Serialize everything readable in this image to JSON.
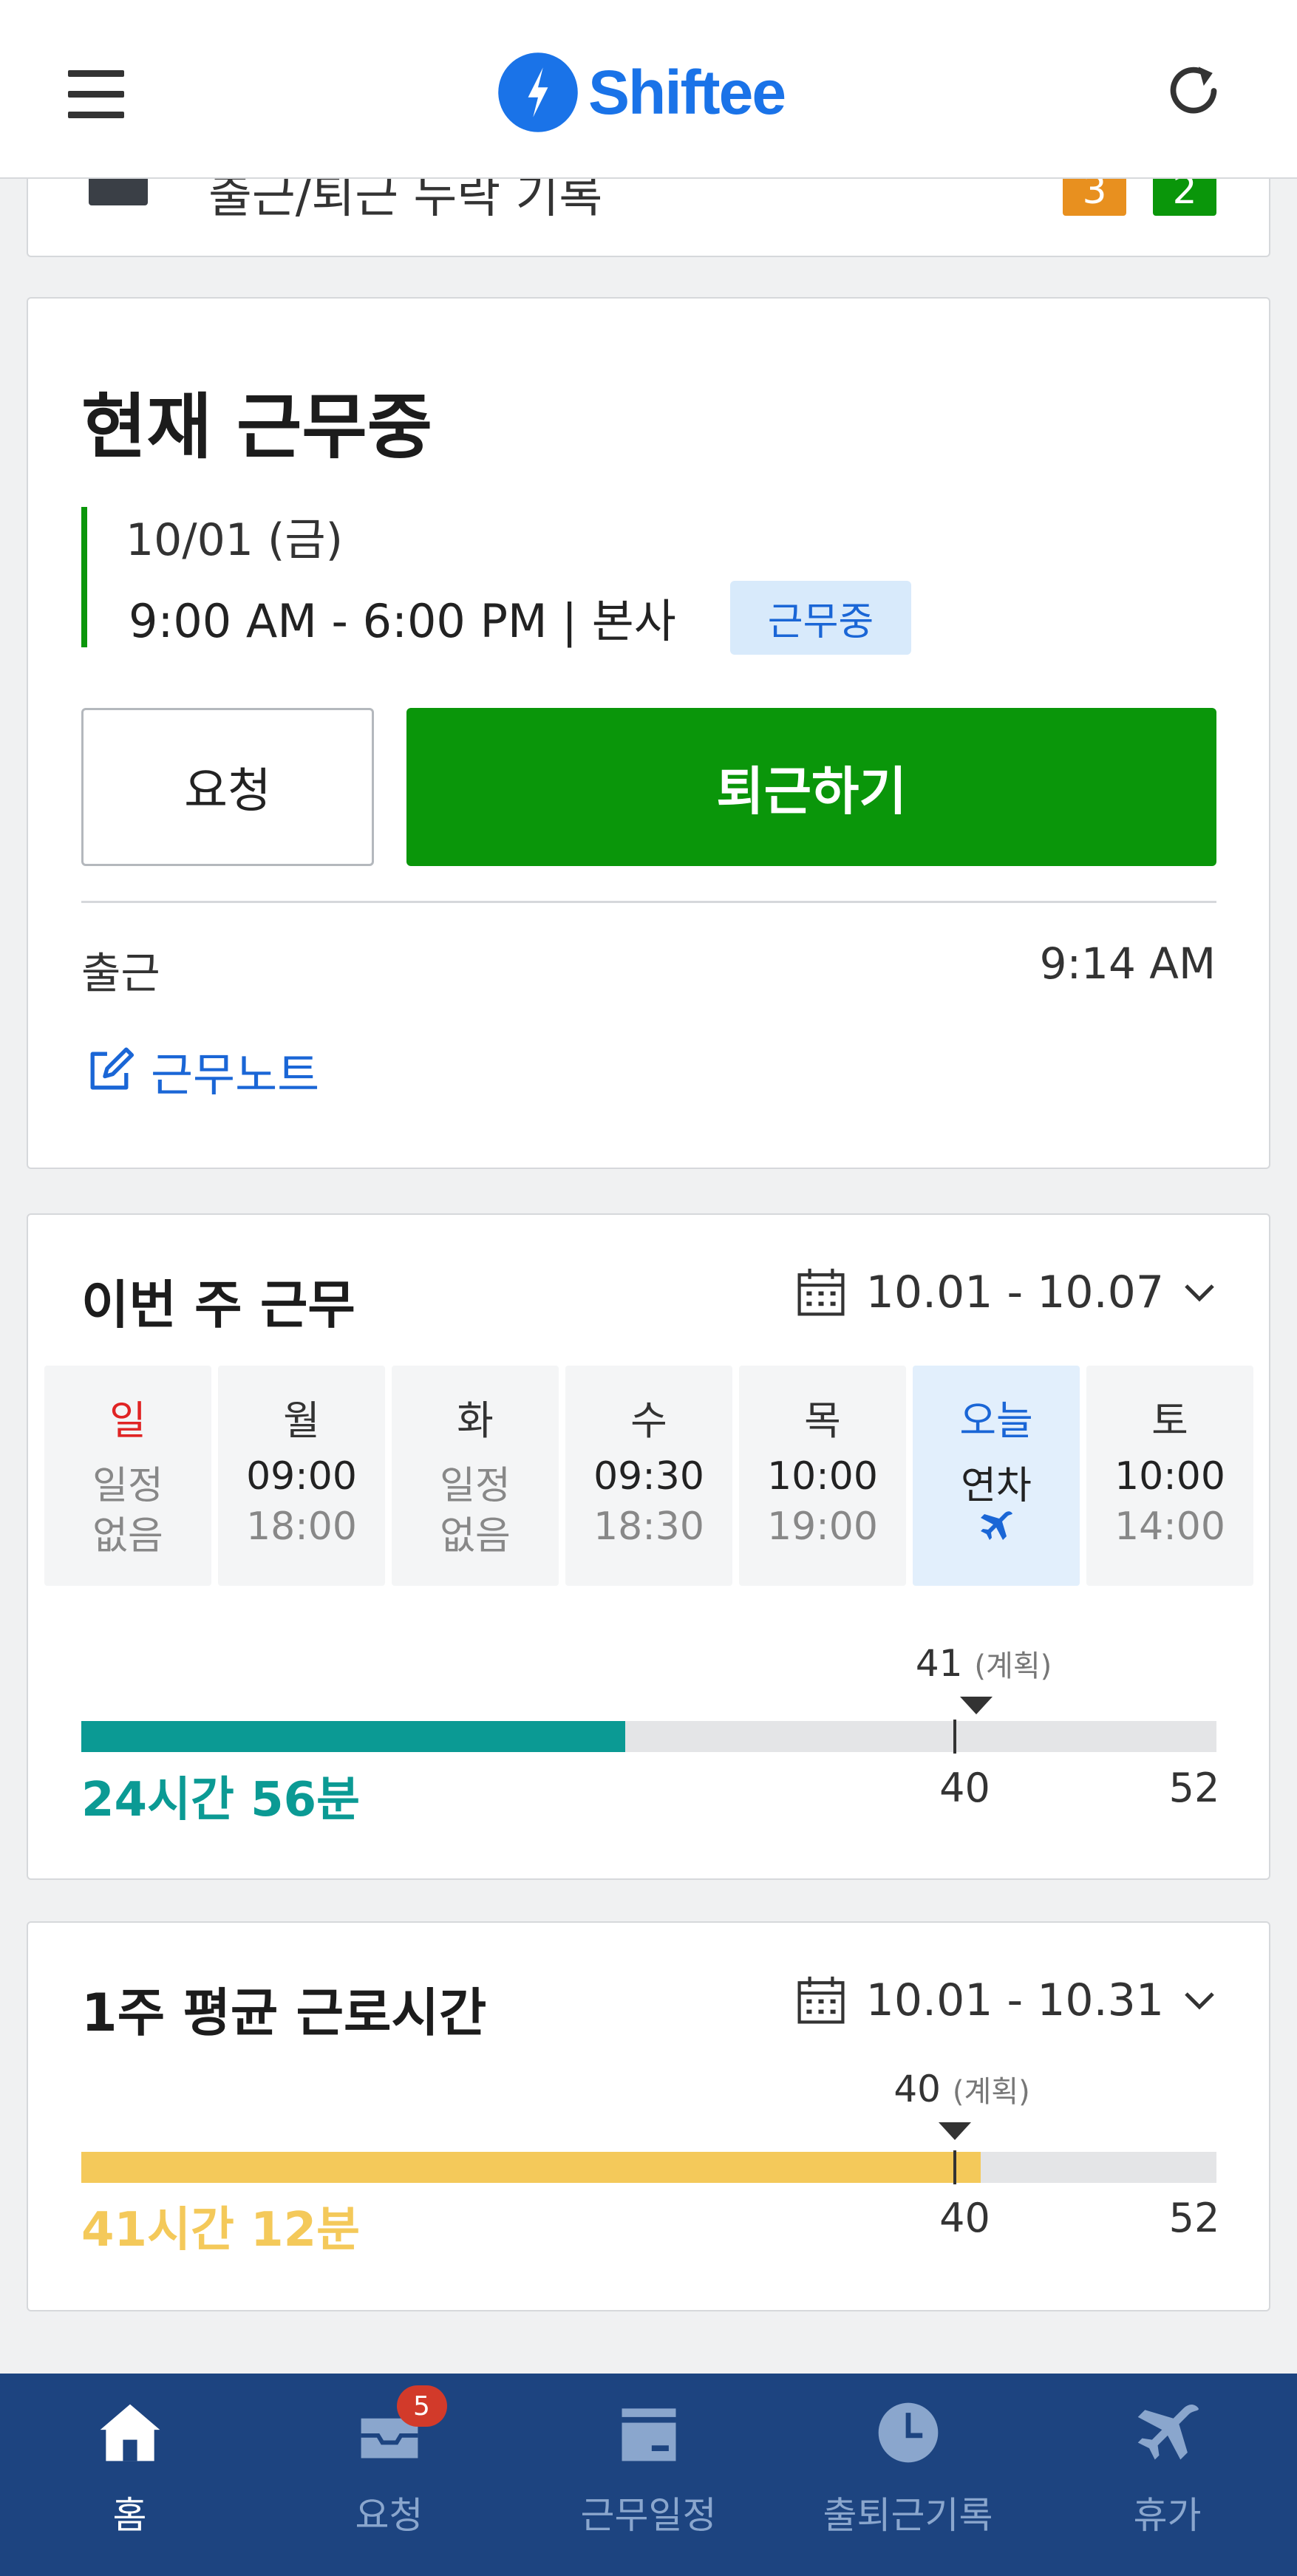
{
  "header": {
    "logo_text": "Shiftee",
    "menu_icon": "hamburger-icon",
    "refresh_icon": "refresh-icon"
  },
  "prev_card": {
    "label": "출근/퇴근 누락 기록",
    "badge_orange": "3",
    "badge_green": "2"
  },
  "current": {
    "title": "현재 근무중",
    "date": "10/01 (금)",
    "time_location": "9:00 AM - 6:00 PM | 본사",
    "status": "근무중",
    "request_label": "요청",
    "leave_label": "퇴근하기",
    "clock_in_label": "출근",
    "clock_in_time": "9:14 AM",
    "note_label": "근무노트",
    "accent": "#0a960a"
  },
  "week": {
    "title": "이번 주 근무",
    "range": "10.01 - 10.07",
    "days": [
      {
        "name": "일",
        "line1": "일정",
        "line2": "없음"
      },
      {
        "name": "월",
        "line1": "09:00",
        "line2": "18:00"
      },
      {
        "name": "화",
        "line1": "일정",
        "line2": "없음"
      },
      {
        "name": "수",
        "line1": "09:30",
        "line2": "18:30"
      },
      {
        "name": "목",
        "line1": "10:00",
        "line2": "19:00"
      },
      {
        "name": "오늘",
        "line1": "연차",
        "line2": ""
      },
      {
        "name": "토",
        "line1": "10:00",
        "line2": "14:00"
      }
    ],
    "worked_label": "24시간 56분",
    "worked_hours": 24.93,
    "plan_value": "41",
    "plan_label": "(계획)",
    "mark_40": "40",
    "max_label": "52",
    "scale_max": 52,
    "fill_color": "#0b9a94"
  },
  "average": {
    "title": "1주 평균 근로시간",
    "range": "10.01 - 10.31",
    "worked_label": "41시간 12분",
    "worked_hours": 41.2,
    "plan_value": "40",
    "plan_label": "(계획)",
    "mark_40": "40",
    "max_label": "52",
    "scale_max": 52,
    "fill_color": "#f4c95a"
  },
  "nav": {
    "items": [
      {
        "label": "홈",
        "icon": "home-icon"
      },
      {
        "label": "요청",
        "icon": "inbox-icon",
        "badge": "5"
      },
      {
        "label": "근무일정",
        "icon": "calendar-icon"
      },
      {
        "label": "출퇴근기록",
        "icon": "clock-icon"
      },
      {
        "label": "휴가",
        "icon": "airplane-icon"
      }
    ]
  }
}
